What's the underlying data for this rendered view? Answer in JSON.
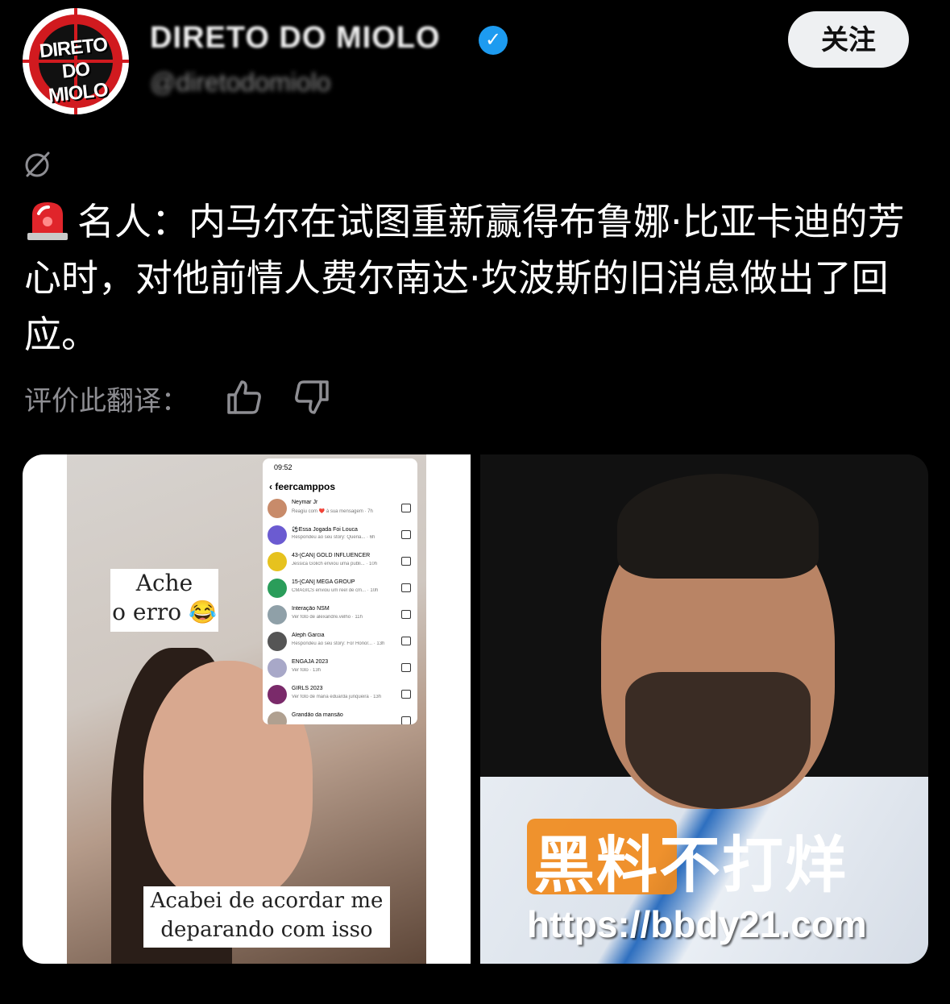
{
  "header": {
    "avatar_logo_line1": "DIRETO",
    "avatar_logo_line2": "DO MIOLO",
    "display_name": "DIRETO DO MIOLO",
    "handle": "@diretodomiolo",
    "follow_label": "关注"
  },
  "tweet": {
    "translate_icon": "globe-slash-icon",
    "emoji": "rotating-light-siren",
    "text": "名人：内马尔在试图重新赢得布鲁娜·比亚卡迪的芳心时，对他前情人费尔南达·坎波斯的旧消息做出了回应。"
  },
  "rating": {
    "label": "评价此翻译：",
    "thumbs_up_icon": "thumbs-up-icon",
    "thumbs_down_icon": "thumbs-down-icon"
  },
  "media": {
    "left": {
      "caption_top_line1": "Ache",
      "caption_top_line2": "o erro 😂",
      "caption_bottom_line1": "Acabei de acordar me",
      "caption_bottom_line2": "deparando com isso",
      "phone": {
        "time": "09:52",
        "username": "‹  feercamppos",
        "rows": [
          {
            "title": "Neymar Jr",
            "sub": "Reagiu com ❤️ à sua mensagem · 7h"
          },
          {
            "title": "⚽Essa Jogada Foi Louca",
            "sub": "Respondeu ao seu story: Queria... · 6h"
          },
          {
            "title": "43-[CAN] GOLD INFLUENCER",
            "sub": "Jessica Golich enviou uma publi... · 10h"
          },
          {
            "title": "15-[CAN] MEGA GROUP",
            "sub": "CMAGICS enviou um reel de cm... · 10h"
          },
          {
            "title": "Interação NSM",
            "sub": "Ver foto de alexandre.velho · 11h"
          },
          {
            "title": "Aleph Garcia",
            "sub": "Respondeu ao seu story: For Honor... · 13h"
          },
          {
            "title": "ENGAJA 2023",
            "sub": "Ver foto · 13h"
          },
          {
            "title": "GIRLS 2023",
            "sub": "Ver foto de maria eduarda junqueira · 13h"
          },
          {
            "title": "Grandão da mansão",
            "sub": ""
          }
        ]
      }
    },
    "right": {
      "watermark_part1": "黑料",
      "watermark_part2": "不打烊",
      "watermark_url": "https://bbdy21.com"
    }
  }
}
